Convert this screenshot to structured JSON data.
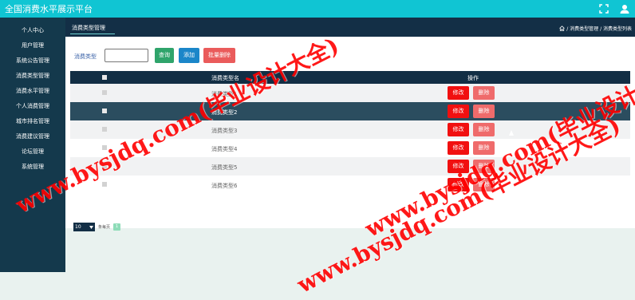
{
  "app": {
    "title": "全国消费水平展示平台"
  },
  "sidebar": {
    "items": [
      {
        "label": "个人中心"
      },
      {
        "label": "用户管理"
      },
      {
        "label": "系统公告管理"
      },
      {
        "label": "消费类型管理"
      },
      {
        "label": "消费水平管理"
      },
      {
        "label": "个人消费管理"
      },
      {
        "label": "城市排名管理"
      },
      {
        "label": "消费建议管理"
      },
      {
        "label": "论坛管理"
      },
      {
        "label": "系统管理"
      }
    ]
  },
  "header": {
    "page_title": "消费类型管理",
    "breadcrumb": {
      "home_icon": "home-icon",
      "path": "/ 消费类型管理 / 消费类型列表"
    }
  },
  "search": {
    "label": "消费类型",
    "placeholder": "",
    "value": ""
  },
  "toolbar": {
    "search_label": "查询",
    "add_label": "添加",
    "batch_delete_label": "批量删除"
  },
  "table": {
    "headers": {
      "name": "消费类型名",
      "ops": "操作"
    },
    "rows": [
      {
        "name": "消费类型1",
        "edit": "修改",
        "delete": "删除"
      },
      {
        "name": "消费类型2",
        "edit": "修改",
        "delete": "删除"
      },
      {
        "name": "消费类型3",
        "edit": "修改",
        "delete": "删除"
      },
      {
        "name": "消费类型4",
        "edit": "修改",
        "delete": "删除"
      },
      {
        "name": "消费类型5",
        "edit": "修改",
        "delete": "删除"
      },
      {
        "name": "消费类型6",
        "edit": "修改",
        "delete": "删除"
      }
    ]
  },
  "pager": {
    "page_size": "10",
    "per_page_text": "条每页",
    "current_page": "1"
  },
  "watermark": {
    "text": "www.bysjdq.com(毕业设计大全)"
  },
  "colors": {
    "topbar": "#10c5d3",
    "sidebar": "#14394c",
    "header": "#132f46",
    "edit": "#f11010",
    "delete": "#ef6b6b",
    "search": "#2fa46b",
    "add": "#1b86c9",
    "watermark": "#ff0000"
  }
}
